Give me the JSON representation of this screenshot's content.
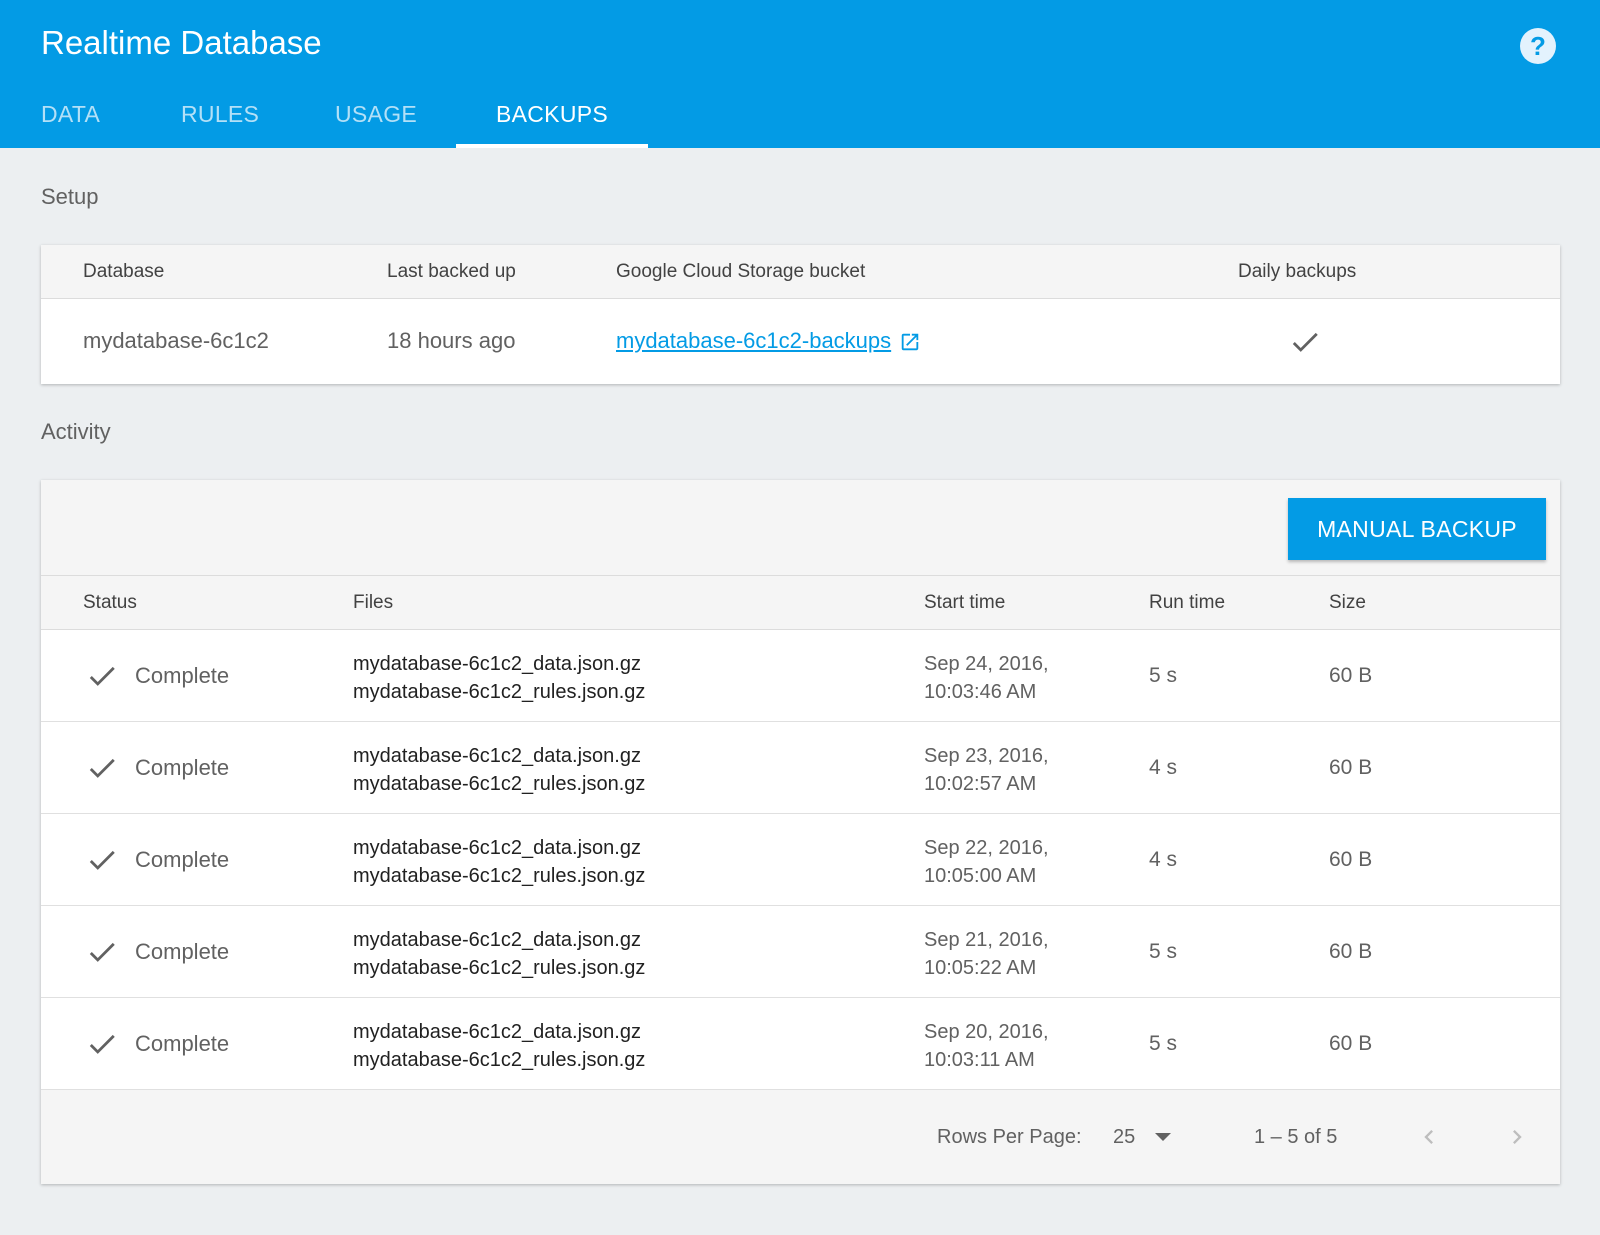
{
  "header": {
    "title": "Realtime Database",
    "help_icon": "help-circle-icon",
    "tabs": [
      {
        "label": "DATA",
        "active": false
      },
      {
        "label": "RULES",
        "active": false
      },
      {
        "label": "USAGE",
        "active": false
      },
      {
        "label": "BACKUPS",
        "active": true
      }
    ]
  },
  "setup": {
    "section_label": "Setup",
    "columns": [
      "Database",
      "Last backed up",
      "Google Cloud Storage bucket",
      "Daily backups"
    ],
    "row": {
      "database": "mydatabase-6c1c2",
      "last_backed_up": "18 hours ago",
      "bucket": "mydatabase-6c1c2-backups",
      "daily_backups": true
    }
  },
  "activity": {
    "section_label": "Activity",
    "manual_backup_label": "MANUAL BACKUP",
    "columns": [
      "Status",
      "Files",
      "Start time",
      "Run time",
      "Size"
    ],
    "rows": [
      {
        "status": "Complete",
        "file1": "mydatabase-6c1c2_data.json.gz",
        "file2": "mydatabase-6c1c2_rules.json.gz",
        "start_date": "Sep 24, 2016,",
        "start_time": "10:03:46 AM",
        "run_time": "5 s",
        "size": "60 B"
      },
      {
        "status": "Complete",
        "file1": "mydatabase-6c1c2_data.json.gz",
        "file2": "mydatabase-6c1c2_rules.json.gz",
        "start_date": "Sep 23, 2016,",
        "start_time": "10:02:57 AM",
        "run_time": "4 s",
        "size": "60 B"
      },
      {
        "status": "Complete",
        "file1": "mydatabase-6c1c2_data.json.gz",
        "file2": "mydatabase-6c1c2_rules.json.gz",
        "start_date": "Sep 22, 2016,",
        "start_time": "10:05:00 AM",
        "run_time": "4 s",
        "size": "60 B"
      },
      {
        "status": "Complete",
        "file1": "mydatabase-6c1c2_data.json.gz",
        "file2": "mydatabase-6c1c2_rules.json.gz",
        "start_date": "Sep 21, 2016,",
        "start_time": "10:05:22 AM",
        "run_time": "5 s",
        "size": "60 B"
      },
      {
        "status": "Complete",
        "file1": "mydatabase-6c1c2_data.json.gz",
        "file2": "mydatabase-6c1c2_rules.json.gz",
        "start_date": "Sep 20, 2016,",
        "start_time": "10:03:11 AM",
        "run_time": "5 s",
        "size": "60 B"
      }
    ],
    "footer": {
      "rows_per_page_label": "Rows Per Page:",
      "rows_per_page_value": "25",
      "range_label": "1 – 5 of  5"
    }
  },
  "colors": {
    "brand": "#039be5",
    "background": "#eceff1"
  }
}
